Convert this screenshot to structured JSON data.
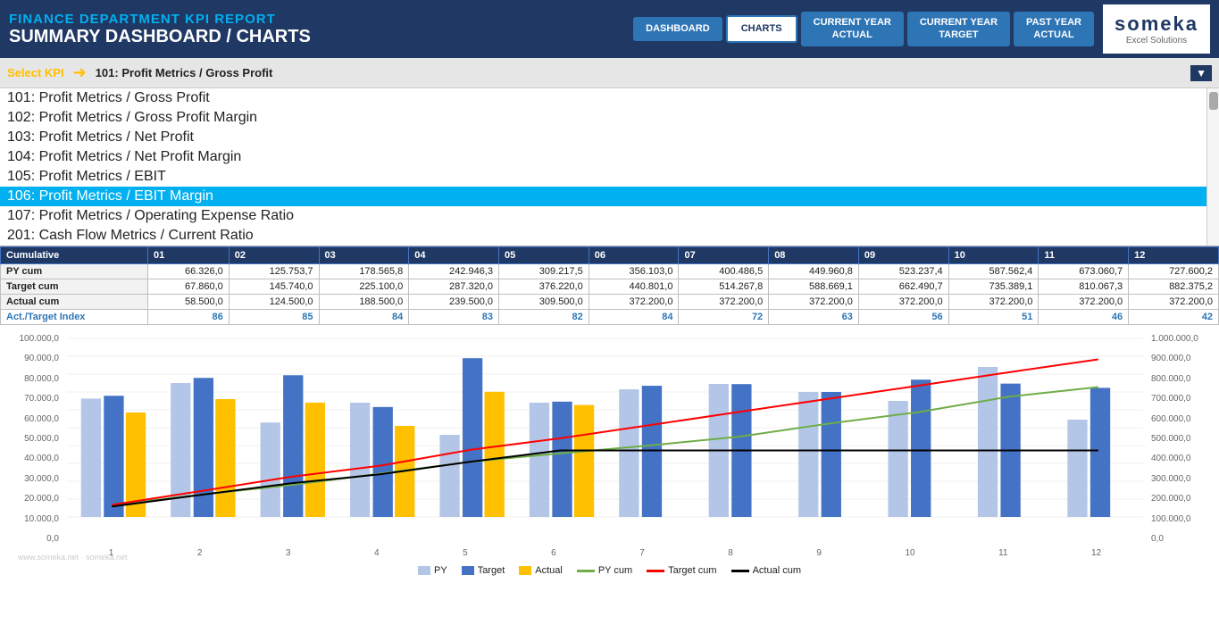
{
  "header": {
    "title_top": "FINANCE DEPARTMENT KPI REPORT",
    "title_bottom": "SUMMARY DASHBOARD / CHARTS",
    "logo_text": "someka",
    "logo_sub": "Excel Solutions",
    "nav": [
      {
        "label": "DASHBOARD",
        "active": false
      },
      {
        "label": "CHARTS",
        "active": true
      },
      {
        "label": "CURRENT YEAR\nACTUAL",
        "active": false
      },
      {
        "label": "CURRENT YEAR\nTARGET",
        "active": false
      },
      {
        "label": "PAST YEAR\nACTUAL",
        "active": false
      }
    ]
  },
  "kpi_selector": {
    "label": "Select KPI",
    "arrow": "➜",
    "selected": "101: Profit Metrics / Gross Profit",
    "items": [
      "101: Profit Metrics / Gross Profit",
      "102: Profit Metrics / Gross Profit Margin",
      "103: Profit Metrics / Net Profit",
      "104: Profit Metrics / Net Profit Margin",
      "105: Profit Metrics / EBIT",
      "106: Profit Metrics / EBIT Margin",
      "107: Profit Metrics / Operating Expense Ratio",
      "201: Cash Flow Metrics / Current Ratio"
    ],
    "selected_index": 5
  },
  "table": {
    "headers": [
      "Cumulative",
      "01",
      "02",
      "03",
      "04",
      "05",
      "06",
      "07",
      "08",
      "09",
      "10",
      "11",
      "12"
    ],
    "rows": [
      {
        "label": "PY cum",
        "values": [
          "66.326,0",
          "125.753,7",
          "178.565,8",
          "242.946,3",
          "309.217,5",
          "356.103,0",
          "400.486,5",
          "449.960,8",
          "523.237,4",
          "587.562,4",
          "673.060,7",
          "727.600,2"
        ]
      },
      {
        "label": "Target cum",
        "values": [
          "67.860,0",
          "145.740,0",
          "225.100,0",
          "287.320,0",
          "376.220,0",
          "440.801,0",
          "514.267,8",
          "588.669,1",
          "662.490,7",
          "735.389,1",
          "810.067,3",
          "882.375,2"
        ]
      },
      {
        "label": "Actual cum",
        "values": [
          "58.500,0",
          "124.500,0",
          "188.500,0",
          "239.500,0",
          "309.500,0",
          "372.200,0",
          "372.200,0",
          "372.200,0",
          "372.200,0",
          "372.200,0",
          "372.200,0",
          "372.200,0"
        ]
      },
      {
        "label": "Act./Target Index",
        "values": [
          "86",
          "85",
          "84",
          "83",
          "82",
          "84",
          "72",
          "63",
          "56",
          "51",
          "46",
          "42"
        ],
        "is_index": true
      }
    ]
  },
  "chart": {
    "y_left_labels": [
      "100.000,0",
      "90.000,0",
      "80.000,0",
      "70.000,0",
      "60.000,0",
      "50.000,0",
      "40.000,0",
      "30.000,0",
      "20.000,0",
      "10.000,0",
      "0,0"
    ],
    "y_right_labels": [
      "1.000.000,0",
      "900.000,0",
      "800.000,0",
      "700.000,0",
      "600.000,0",
      "500.000,0",
      "400.000,0",
      "300.000,0",
      "200.000,0",
      "100.000,0",
      "0,0"
    ],
    "x_labels": [
      "1",
      "2",
      "3",
      "4",
      "5",
      "6",
      "7",
      "8",
      "9",
      "10",
      "11",
      "12"
    ],
    "py_bars": [
      66326,
      75000,
      52890,
      64000,
      46000,
      64000,
      71500,
      74500,
      70000,
      65000,
      84000,
      54500
    ],
    "target_bars": [
      67860,
      77880,
      79360,
      61580,
      88900,
      64581,
      73467,
      74402,
      70000,
      76900,
      74678,
      72308
    ],
    "actual_bars": [
      58500,
      66000,
      64000,
      51000,
      70100,
      62700,
      0,
      0,
      0,
      0,
      0,
      0
    ],
    "py_cum": [
      66326,
      125754,
      178566,
      242946,
      309218,
      356103,
      400487,
      449961,
      523237,
      587562,
      673061,
      727600
    ],
    "target_cum": [
      67860,
      145740,
      225100,
      287320,
      376220,
      440801,
      514268,
      588669,
      662491,
      735389,
      810067,
      882375
    ],
    "actual_cum": [
      58500,
      124500,
      188500,
      239500,
      309500,
      372200,
      372200,
      372200,
      372200,
      372200,
      372200,
      372200
    ],
    "legend": [
      {
        "label": "PY",
        "type": "bar",
        "color": "#b4c6e7"
      },
      {
        "label": "Target",
        "type": "bar",
        "color": "#4472c4"
      },
      {
        "label": "Actual",
        "type": "bar",
        "color": "#ffc000"
      },
      {
        "label": "PY cum",
        "type": "line",
        "color": "#70ad47"
      },
      {
        "label": "Target cum",
        "type": "line",
        "color": "#ff0000"
      },
      {
        "label": "Actual cum",
        "type": "line",
        "color": "#000000"
      }
    ]
  },
  "watermark": "www.someka.net · someka.net"
}
